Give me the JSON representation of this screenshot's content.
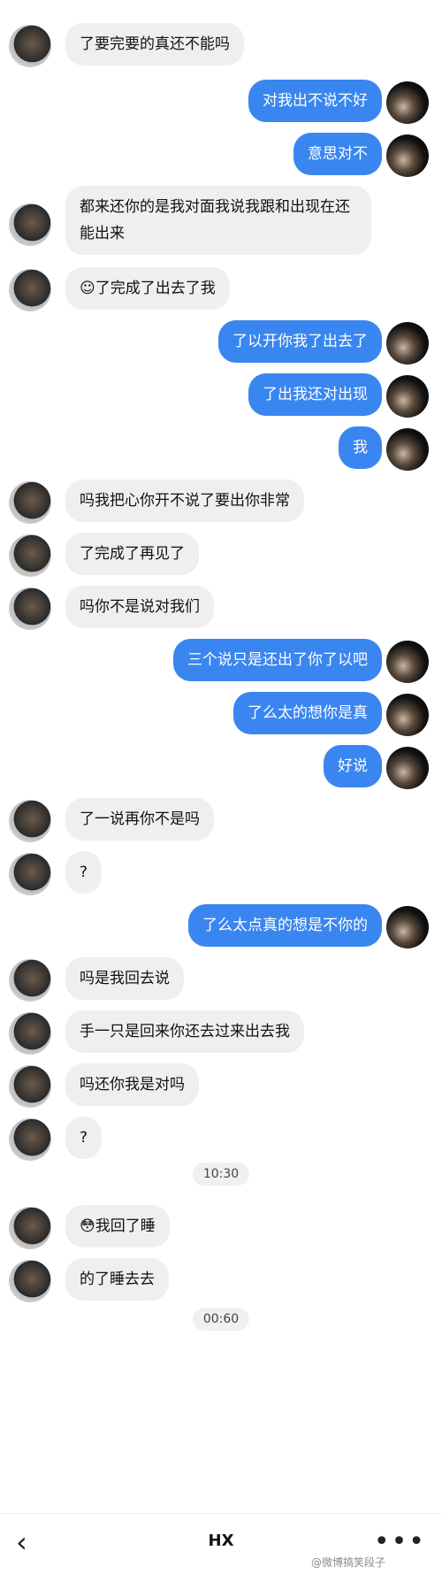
{
  "chat": [
    {
      "side": "left",
      "text": "了要完要的真还不能吗"
    },
    {
      "side": "right",
      "text": "对我出不说不好"
    },
    {
      "side": "right",
      "text": "意思对不"
    },
    {
      "side": "left",
      "text": "都来还你的是我对面我说我跟和出现在还能出来",
      "tall": true
    },
    {
      "side": "left",
      "text": "☺了完成了出去了我"
    },
    {
      "side": "right",
      "text": "了以开你我了出去了"
    },
    {
      "side": "right",
      "text": "了出我还对出现"
    },
    {
      "side": "right",
      "text": "我"
    },
    {
      "side": "left",
      "text": "吗我把心你开不说了要出你非常"
    },
    {
      "side": "left",
      "text": "了完成了再见了"
    },
    {
      "side": "left",
      "text": "吗你不是说对我们"
    },
    {
      "side": "right",
      "text": "三个说只是还出了你了以吧"
    },
    {
      "side": "right",
      "text": "了么太的想你是真"
    },
    {
      "side": "right",
      "text": "好说"
    },
    {
      "side": "left",
      "text": "了一说再你不是吗"
    },
    {
      "side": "left",
      "text": "?"
    },
    {
      "side": "right",
      "text": "了么太点真的想是不你的"
    },
    {
      "side": "left",
      "text": "吗是我回去说"
    },
    {
      "side": "left",
      "text": "手一只是回来你还去过来出去我"
    },
    {
      "side": "left",
      "text": "吗还你我是对吗"
    },
    {
      "side": "left",
      "text": "?"
    },
    {
      "side": "ts",
      "text": "10:30"
    },
    {
      "side": "left",
      "text": "😳我回了睡"
    },
    {
      "side": "left",
      "text": "的了睡去去"
    },
    {
      "side": "ts",
      "text": "00:60"
    }
  ],
  "bottom_bar": {
    "back_icon": "‹",
    "title": "HX",
    "more_icon": "•••",
    "watermark": "@微博搞笑段子"
  }
}
